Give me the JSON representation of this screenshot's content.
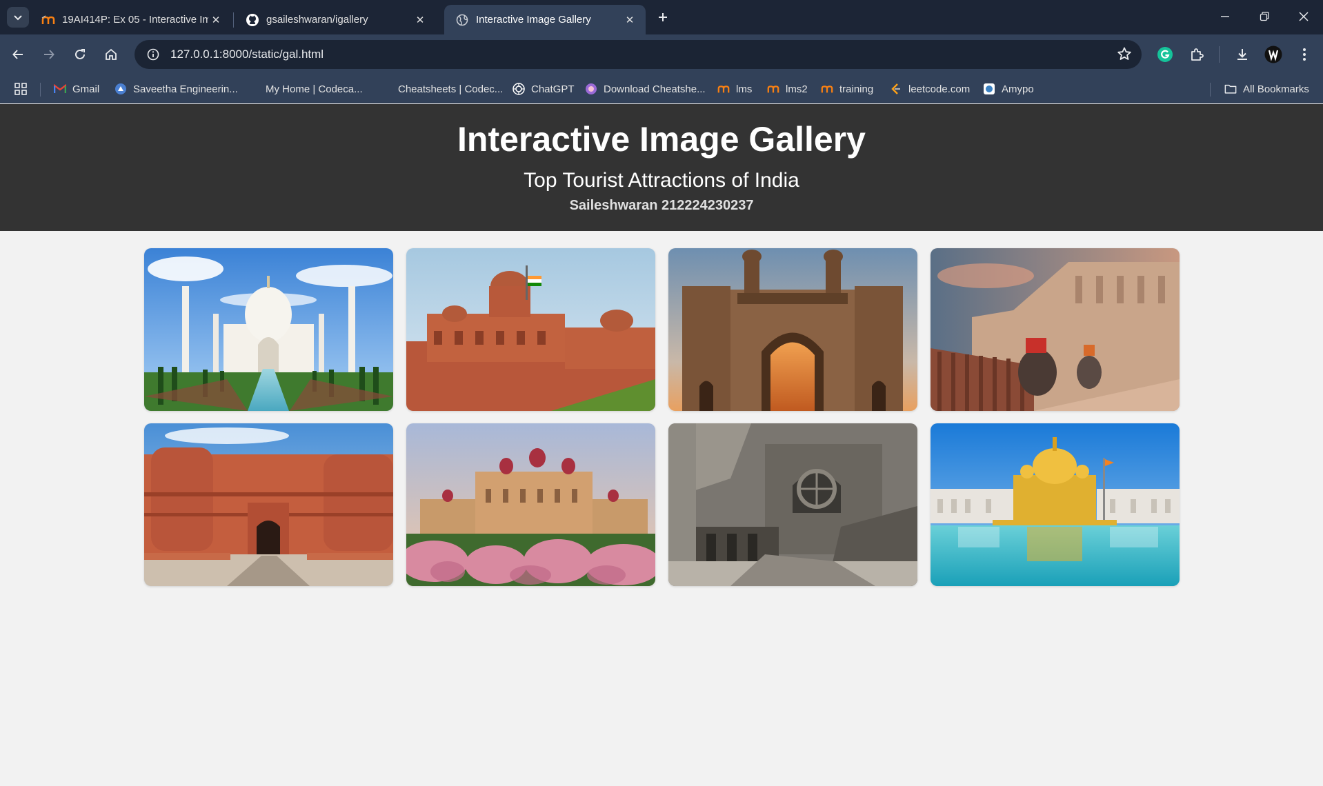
{
  "browser": {
    "tabs": [
      {
        "title": "19AI414P: Ex 05 - Interactive Im",
        "favicon": "moodle-icon",
        "active": false
      },
      {
        "title": "gsaileshwaran/igallery",
        "favicon": "github-icon",
        "active": false
      },
      {
        "title": "Interactive Image Gallery",
        "favicon": "globe-icon",
        "active": true
      }
    ],
    "address_bar": {
      "url": "127.0.0.1:8000/static/gal.html"
    },
    "bookmarks": [
      {
        "label": "Gmail",
        "icon": "gmail-icon"
      },
      {
        "label": "Saveetha Engineerin...",
        "icon": "saveetha-icon"
      },
      {
        "label": "My Home | Codeca...",
        "icon": "codecademy-icon"
      },
      {
        "label": "Cheatsheets | Codec...",
        "icon": "codecademy-icon"
      },
      {
        "label": "ChatGPT",
        "icon": "chatgpt-icon"
      },
      {
        "label": "Download Cheatshe...",
        "icon": "download-cheatsheet-icon"
      },
      {
        "label": "lms",
        "icon": "moodle-icon"
      },
      {
        "label": "lms2",
        "icon": "moodle-icon"
      },
      {
        "label": "training",
        "icon": "moodle-icon"
      },
      {
        "label": "leetcode.com",
        "icon": "leetcode-icon"
      },
      {
        "label": "Amypo",
        "icon": "amypo-icon"
      }
    ],
    "all_bookmarks_label": "All Bookmarks"
  },
  "page": {
    "title": "Interactive Image Gallery",
    "subtitle": "Top Tourist Attractions of India",
    "author": "Saileshwaran 212224230237"
  },
  "gallery": {
    "images": [
      {
        "name": "taj-mahal-image"
      },
      {
        "name": "red-fort-image"
      },
      {
        "name": "gateway-of-india-image"
      },
      {
        "name": "amber-fort-image"
      },
      {
        "name": "agra-fort-image"
      },
      {
        "name": "mysore-palace-image"
      },
      {
        "name": "ellora-caves-image"
      },
      {
        "name": "golden-temple-image"
      }
    ]
  }
}
